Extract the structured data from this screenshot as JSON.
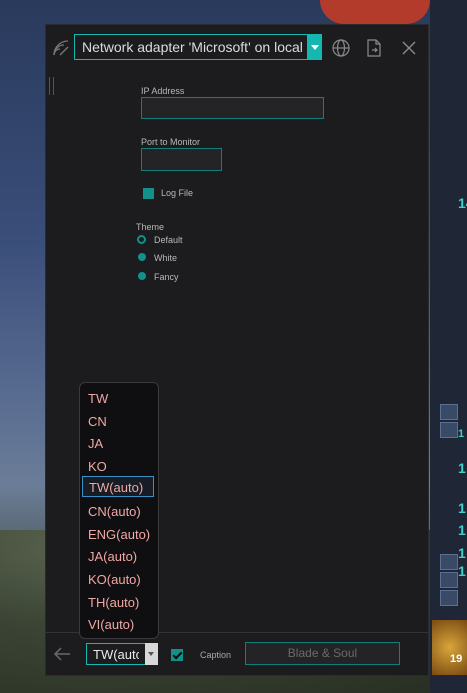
{
  "window": {
    "adapter_select": {
      "value": "Network adapter 'Microsoft' on local"
    },
    "icons": {
      "app": "signal-icon",
      "globe": "globe-icon",
      "export": "export-file-icon",
      "close": "close-icon"
    }
  },
  "settings": {
    "ip_address_label": "IP Address",
    "ip_address_value": "",
    "port_label": "Port to Monitor",
    "port_value": "",
    "log_file_label": "Log File",
    "theme_label": "Theme",
    "theme_options": [
      "Default",
      "White",
      "Fancy"
    ]
  },
  "language_dropdown": {
    "options": [
      "TW",
      "CN",
      "JA",
      "KO",
      "TW(auto)",
      "CN(auto)",
      "ENG(auto)",
      "JA(auto)",
      "KO(auto)",
      "TH(auto)",
      "VI(auto)"
    ],
    "highlighted": "TW(auto)"
  },
  "bottom_bar": {
    "language_value": "TW(auto)",
    "caption_label": "Caption",
    "game_button_label": "Blade & Soul"
  },
  "colors": {
    "accent": "#16b7b0",
    "background": "#1c1c1e",
    "list_text": "#f0a8a4"
  },
  "background_game_ui": {
    "numbers": [
      "14",
      "1",
      "1",
      "1",
      "1",
      "1",
      "1",
      "19"
    ]
  }
}
